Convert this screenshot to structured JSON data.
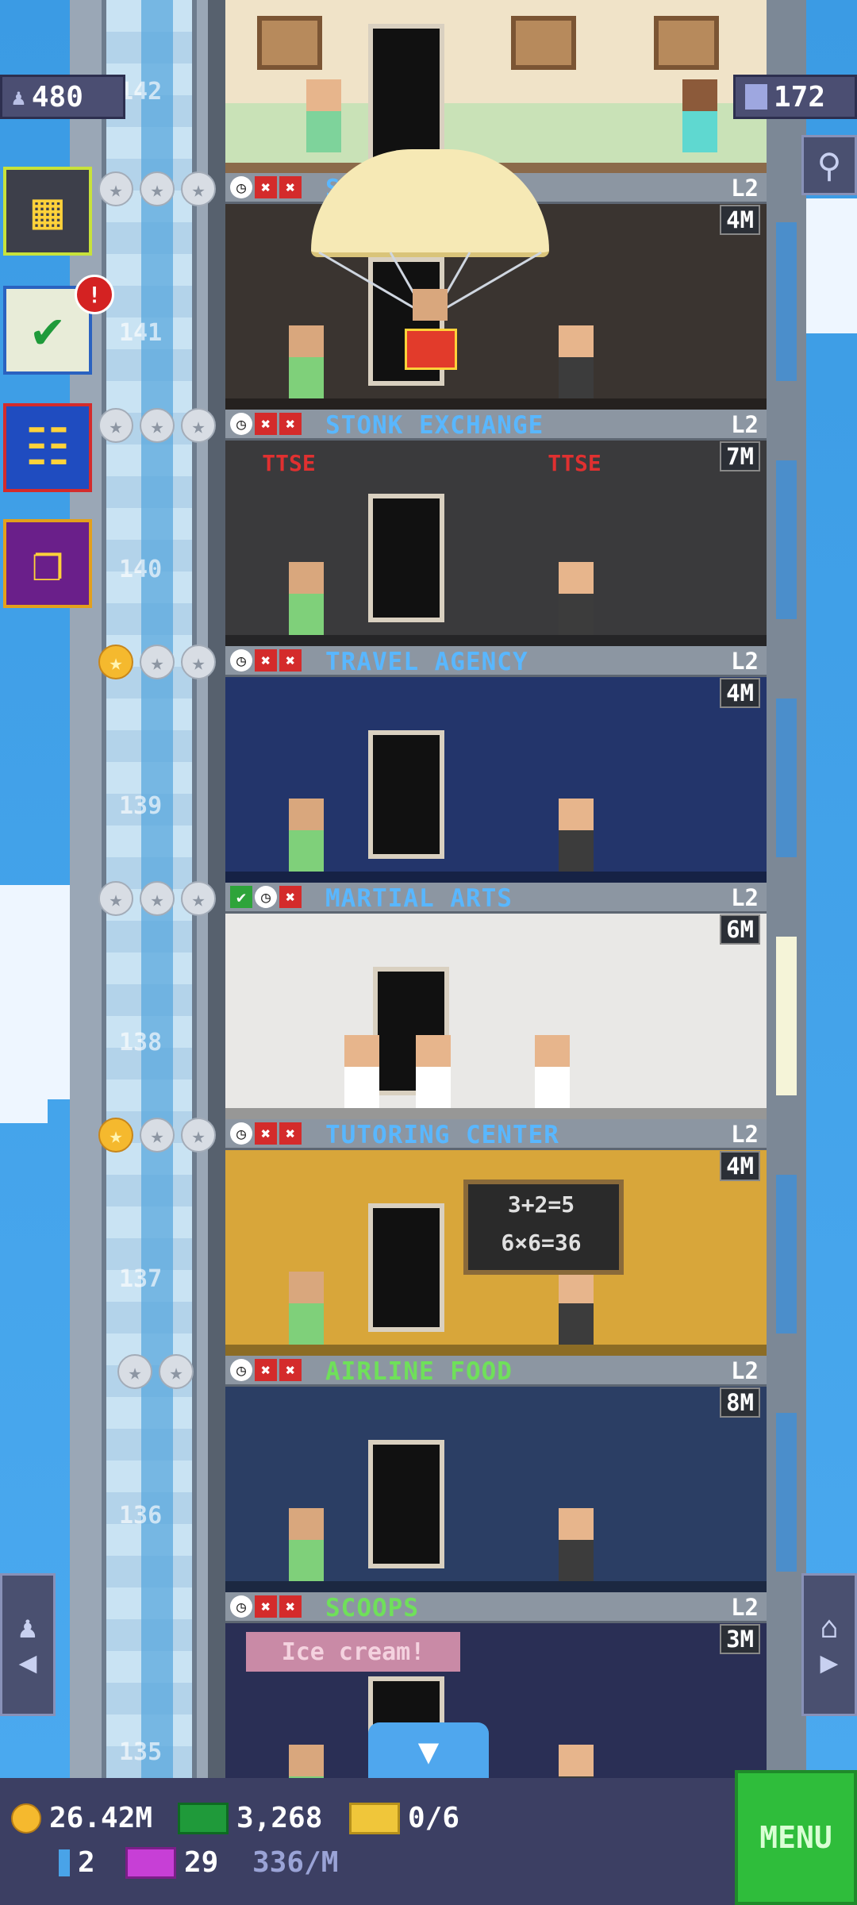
{
  "top": {
    "population": "480",
    "floors_count": "172",
    "top_floor_number": "142"
  },
  "floors": [
    {
      "number": "141",
      "name": "S... ...N",
      "level": "L2",
      "price": "4M",
      "stars_gold": 0,
      "stars_total": 3,
      "name_color": "#59b7ff",
      "status": [
        "clock",
        "x",
        "x"
      ],
      "room_color": "#3a3430"
    },
    {
      "number": "140",
      "name": "STONK EXCHANGE",
      "level": "L2",
      "price": "7M",
      "stars_gold": 0,
      "stars_total": 3,
      "name_color": "#59b7ff",
      "status": [
        "clock",
        "x",
        "x"
      ],
      "room_color": "#3a3a3c"
    },
    {
      "number": "139",
      "name": "TRAVEL AGENCY",
      "level": "L2",
      "price": "4M",
      "stars_gold": 1,
      "stars_total": 3,
      "name_color": "#59b7ff",
      "status": [
        "clock",
        "x",
        "x"
      ],
      "room_color": "#23356b"
    },
    {
      "number": "138",
      "name": "MARTIAL ARTS",
      "level": "L2",
      "price": "6M",
      "stars_gold": 0,
      "stars_total": 3,
      "name_color": "#59b7ff",
      "status": [
        "ok",
        "clock",
        "x"
      ],
      "room_color": "#e9e8e6"
    },
    {
      "number": "137",
      "name": "TUTORING CENTER",
      "level": "L2",
      "price": "4M",
      "stars_gold": 1,
      "stars_total": 3,
      "name_color": "#59b7ff",
      "status": [
        "clock",
        "x",
        "x"
      ],
      "room_color": "#d8a63a"
    },
    {
      "number": "136",
      "name": "AIRLINE FOOD",
      "level": "L2",
      "price": "8M",
      "stars_gold": 0,
      "stars_total": 2,
      "name_color": "#6fe05a",
      "status": [
        "clock",
        "x",
        "x"
      ],
      "room_color": "#2b3e64"
    },
    {
      "number": "135",
      "name": "SCOOPS",
      "level": "L2",
      "price": "3M",
      "stars_gold": 0,
      "stars_total": 0,
      "name_color": "#6fe05a",
      "status": [
        "clock",
        "x",
        "x"
      ],
      "room_color": "#2a2f55"
    }
  ],
  "room_signs": {
    "stonk_left": "TTSE",
    "stonk_right": "TTSE",
    "tutoring_board_1": "3+2=5",
    "tutoring_board_2": "6×6=36",
    "scoops_sign": "Ice cream!"
  },
  "side_buttons": [
    {
      "name": "build-floor-button",
      "icon": "building-icon",
      "border": "#c8e23a",
      "bg": "#3d3f4a"
    },
    {
      "name": "missions-button",
      "icon": "checklist-icon",
      "border": "#2a62c0",
      "bg": "#e8ecd8",
      "badge": "!"
    },
    {
      "name": "calendar-button",
      "icon": "calendar-icon",
      "border": "#d42b2b",
      "bg": "#1f4cc0"
    },
    {
      "name": "gift-button",
      "icon": "gift-icon",
      "border": "#e3a01b",
      "bg": "#6a1f8a"
    }
  ],
  "bottom": {
    "coins": "26.42M",
    "tower_bux": "3,268",
    "tickets": "0/6",
    "keys": "2",
    "vip": "29",
    "income_rate": "336/M",
    "menu_label": "MENU"
  },
  "colors": {
    "accent": "#59b7ff",
    "menu": "#2fbd3b",
    "bar": "#3c3f63"
  }
}
